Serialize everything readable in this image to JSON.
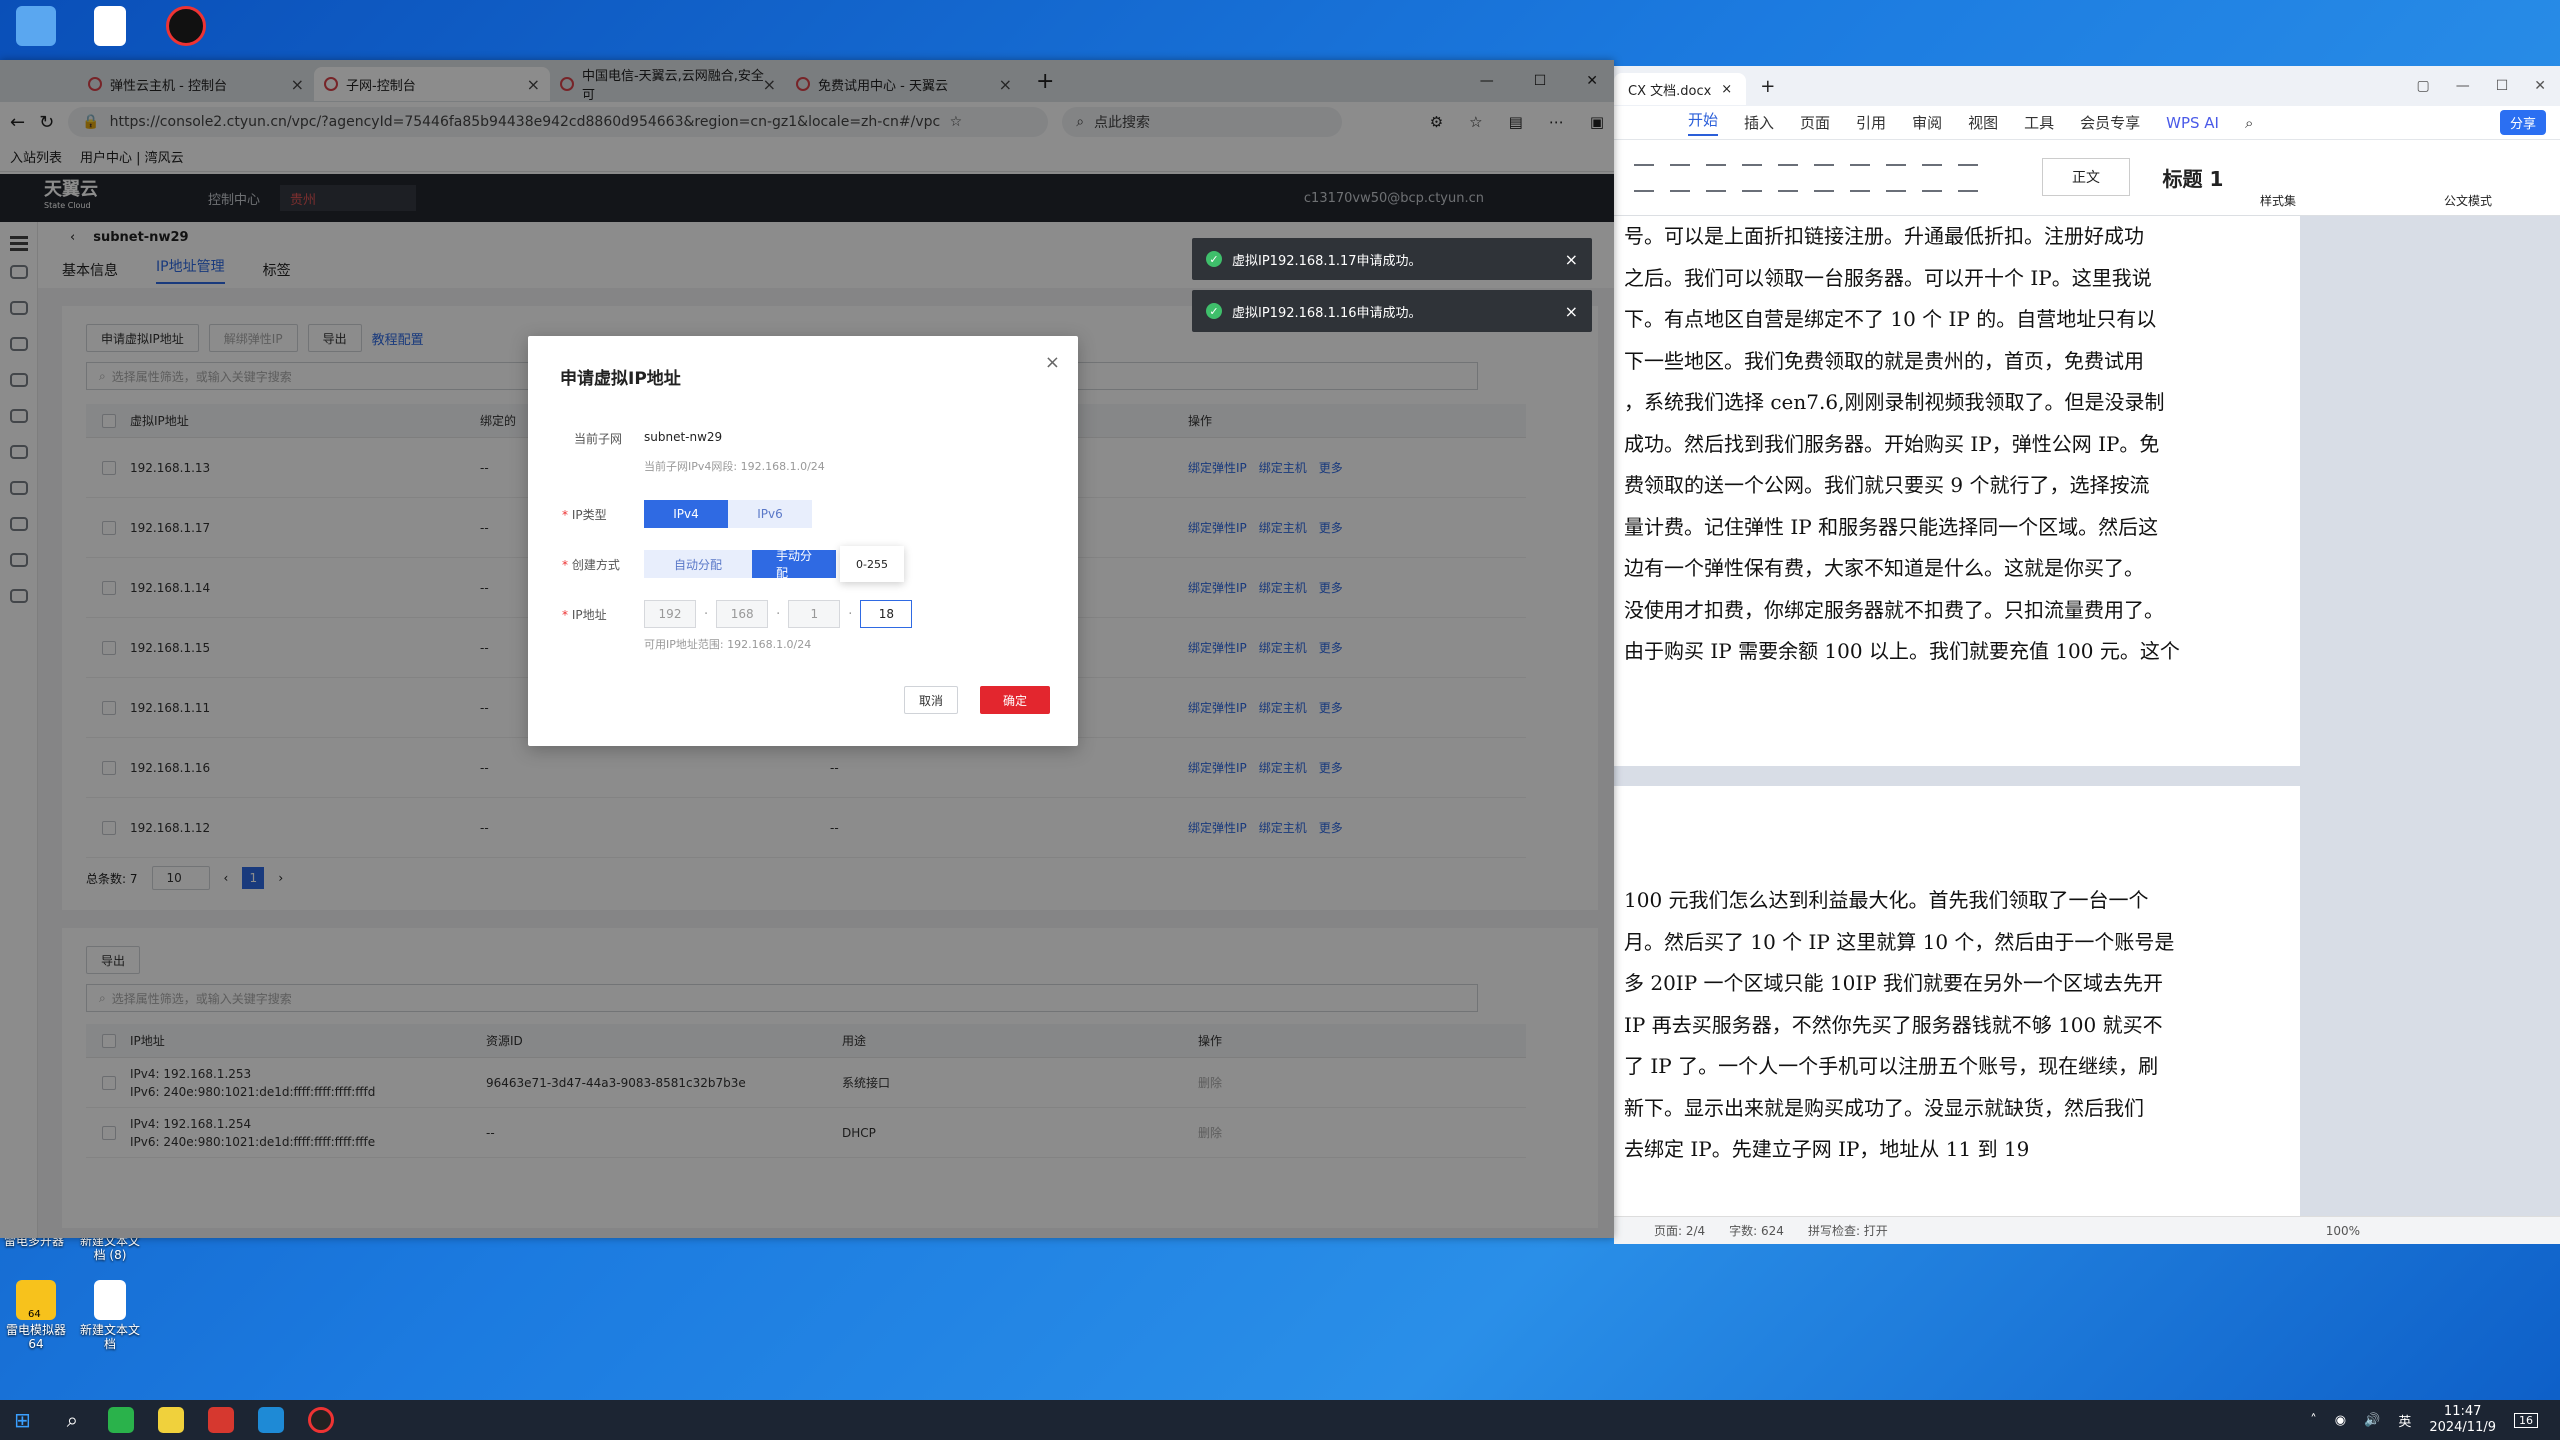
{
  "desktop": {
    "icons": [
      {
        "label": ""
      },
      {
        "label": ""
      },
      {
        "label": ""
      },
      {
        "label": "雷电多开器"
      },
      {
        "label": "新建文本文档 (8)"
      },
      {
        "label": "雷电模拟器64"
      },
      {
        "label": "新建文本文档"
      }
    ],
    "badge64": "64"
  },
  "browser": {
    "tabs": [
      "弹性云主机 - 控制台",
      "子网-控制台",
      "中国电信-天翼云,云网融合,安全可",
      "免费试用中心 - 天翼云"
    ],
    "url": "https://console2.ctyun.cn/vpc/?agencyId=75446fa85b94438e942cd8860d954663&region=cn-gz1&locale=zh-cn#/vpc/subnets/d...",
    "search_placeholder": "点此搜索",
    "bookmarks": [
      "入站列表",
      "用户中心 | 湾风云"
    ]
  },
  "console": {
    "logo": "天翼云",
    "logo_sub": "State Cloud",
    "control_center": "控制中心",
    "region": "贵州",
    "account": "c13170vw50@bcp.ctyun.cn",
    "subnet_name": "subnet-nw29",
    "tabs": [
      "基本信息",
      "IP地址管理",
      "标签"
    ],
    "buttons": {
      "apply": "申请虚拟IP地址",
      "unbind": "解绑弹性IP",
      "export": "导出",
      "tutorial": "教程配置"
    },
    "search_placeholder": "选择属性筛选，或输入关键字搜索",
    "headers": [
      "虚拟IP地址",
      "绑定的",
      "",
      "",
      "操作"
    ],
    "rows": [
      {
        "ip": "192.168.1.13",
        "bound": "--",
        "col3": ""
      },
      {
        "ip": "192.168.1.17",
        "bound": "--",
        "col3": ""
      },
      {
        "ip": "192.168.1.14",
        "bound": "--",
        "col3": ""
      },
      {
        "ip": "192.168.1.15",
        "bound": "--",
        "col3": ""
      },
      {
        "ip": "192.168.1.11",
        "bound": "--",
        "col3": "--"
      },
      {
        "ip": "192.168.1.16",
        "bound": "--",
        "col3": "--"
      },
      {
        "ip": "192.168.1.12",
        "bound": "--",
        "col3": "--"
      }
    ],
    "row_actions": {
      "bind_eip": "绑定弹性IP",
      "bind_host": "绑定主机",
      "more": "更多"
    },
    "pager": {
      "total": "总条数: 7",
      "size": "10",
      "page": "1"
    },
    "card2": {
      "export": "导出",
      "search_placeholder": "选择属性筛选，或输入关键字搜索",
      "headers": [
        "IP地址",
        "资源ID",
        "用途",
        "操作"
      ],
      "rows": [
        {
          "ip4": "IPv4: 192.168.1.253",
          "ip6": "IPv6: 240e:980:1021:de1d:ffff:ffff:ffff:fffd",
          "rid": "96463e71-3d47-44a3-9083-8581c32b7b3e",
          "use": "系统接口",
          "op": "删除"
        },
        {
          "ip4": "IPv4: 192.168.1.254",
          "ip6": "IPv6: 240e:980:1021:de1d:ffff:ffff:ffff:fffe",
          "rid": "--",
          "use": "DHCP",
          "op": "删除"
        }
      ]
    }
  },
  "dialog": {
    "title": "申请虚拟IP地址",
    "subnet_label": "当前子网",
    "subnet_value": "subnet-nw29",
    "subnet_hint": "当前子网IPv4网段: 192.168.1.0/24",
    "iptype_label": "IP类型",
    "ipv4": "IPv4",
    "ipv6": "IPv6",
    "method_label": "创建方式",
    "auto": "自动分配",
    "manual": "手动分配",
    "ip_label": "IP地址",
    "oct1": "192",
    "oct2": "168",
    "oct3": "1",
    "oct4": "18",
    "range_hint": "可用IP地址范围: 192.168.1.0/24",
    "tooltip": "0-255",
    "cancel": "取消",
    "ok": "确定"
  },
  "toasts": [
    "虚拟IP192.168.1.17申请成功。",
    "虚拟IP192.168.1.16申请成功。"
  ],
  "wps": {
    "tab": "CX 文档.docx",
    "menu": [
      "开始",
      "插入",
      "页面",
      "引用",
      "审阅",
      "视图",
      "工具",
      "会员专享",
      "WPS AI"
    ],
    "share": "分享",
    "style_normal": "正文",
    "style_heading": "标题 1",
    "style_label": "样式集",
    "doc_mode": "公文模式",
    "page1": [
      "号。可以是上面折扣链接注册。升通最低折扣。注册好成功",
      "之后。我们可以领取一台服务器。可以开十个 IP。这里我说",
      "下。有点地区自营是绑定不了 10 个 IP 的。自营地址只有以",
      "下一些地区。我们免费领取的就是贵州的，首页，免费试用",
      "，系统我们选择 cen7.6,刚刚录制视频我领取了。但是没录制",
      "成功。然后找到我们服务器。开始购买 IP，弹性公网 IP。免",
      "费领取的送一个公网。我们就只要买 9 个就行了，选择按流",
      "量计费。记住弹性 IP 和服务器只能选择同一个区域。然后这",
      "边有一个弹性保有费，大家不知道是什么。这就是你买了。",
      "没使用才扣费，你绑定服务器就不扣费了。只扣流量费用了。",
      "由于购买 IP 需要余额 100 以上。我们就要充值 100 元。这个"
    ],
    "page2": [
      "100 元我们怎么达到利益最大化。首先我们领取了一台一个",
      "月。然后买了 10 个 IP 这里就算 10 个，然后由于一个账号是",
      "多 20IP 一个区域只能 10IP 我们就要在另外一个区域去先开",
      "IP 再去买服务器，不然你先买了服务器钱就不够 100 就买不",
      "了 IP 了。一个人一个手机可以注册五个账号，现在继续，刷",
      "新下。显示出来就是购买成功了。没显示就缺货，然后我们",
      "去绑定 IP。先建立子网 IP，地址从 11 到 19"
    ],
    "status": {
      "page": "页面: 2/4",
      "words": "字数: 624",
      "spell": "拼写检查: 打开",
      "zoom": "100%"
    }
  },
  "taskbar": {
    "time": "11:47",
    "date": "2024/11/9",
    "lang": "英",
    "notif": "16"
  }
}
